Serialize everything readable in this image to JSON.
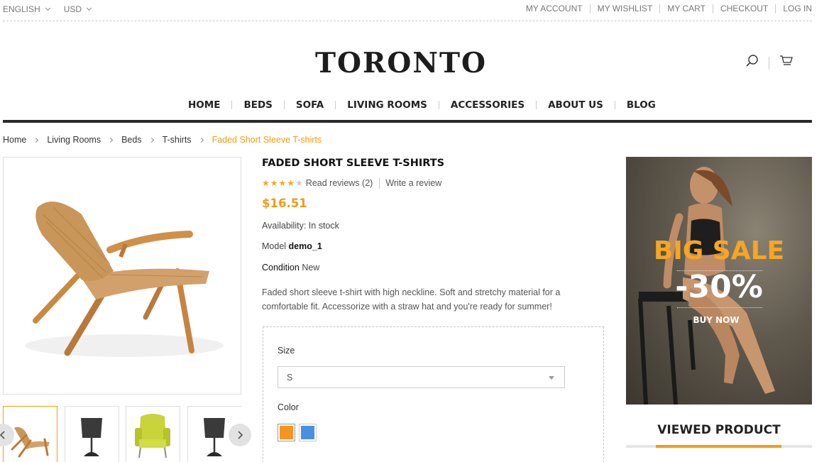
{
  "topbar": {
    "language": "ENGLISH",
    "currency": "USD",
    "links": [
      "MY ACCOUNT",
      "MY WISHLIST",
      "MY CART",
      "CHECKOUT",
      "LOG IN"
    ]
  },
  "header": {
    "logo": "TORONTO",
    "icons": [
      "search-icon",
      "cart-icon"
    ]
  },
  "nav": [
    "HOME",
    "BEDS",
    "SOFA",
    "LIVING ROOMS",
    "ACCESSORIES",
    "ABOUT US",
    "BLOG"
  ],
  "breadcrumb": [
    "Home",
    "Living Rooms",
    "Beds",
    "T-shirts",
    "Faded Short Sleeve T-shirts"
  ],
  "product": {
    "title": "FADED SHORT SLEEVE T-SHIRTS",
    "rating": 4,
    "rating_max": 5,
    "read_reviews": "Read reviews (2)",
    "write_review": "Write a review",
    "price": "$16.51",
    "availability_label": "Availability:",
    "availability_value": "In stock",
    "model_label": "Model",
    "model_value": "demo_1",
    "condition_label": "Condition",
    "condition_value": "New",
    "description": "Faded short sleeve t-shirt with high neckline. Soft and stretchy material for a comfortable fit. Accessorize with a straw hat and you're ready for summer!",
    "size_label": "Size",
    "size_value": "S",
    "color_label": "Color",
    "colors": [
      "#f7941d",
      "#4a90e2"
    ]
  },
  "banner": {
    "title": "BIG SALE",
    "discount": "-30%",
    "cta": "BUY NOW"
  },
  "viewed": {
    "title": "VIEWED PRODUCT"
  },
  "colors": {
    "accent": "#f39c11"
  }
}
